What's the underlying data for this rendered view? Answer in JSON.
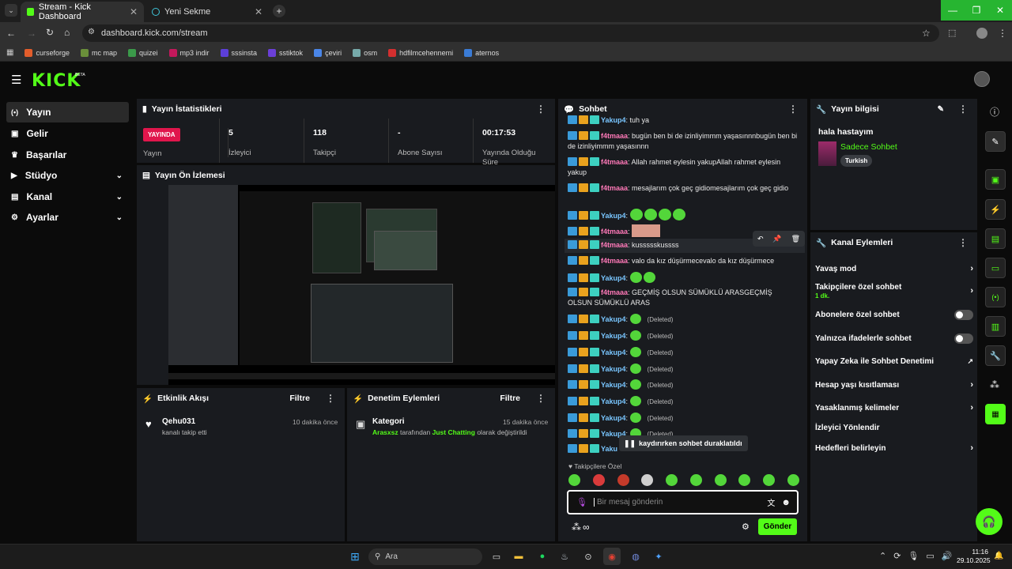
{
  "browser": {
    "tabs": [
      {
        "title": "Stream - Kick Dashboard",
        "active": true
      },
      {
        "title": "Yeni Sekme",
        "active": false
      }
    ],
    "url": "dashboard.kick.com/stream",
    "bookmarks": [
      "curseforge",
      "mc map",
      "quizei",
      "mp3 indir",
      "sssinsta",
      "sstiktok",
      "çeviri",
      "osm",
      "hdfilmcehennemi",
      "aternos"
    ]
  },
  "brand": {
    "logo": "KICK",
    "beta": "BETA",
    "accent": "#53fc18"
  },
  "nav": {
    "items": [
      {
        "label": "Yayın",
        "icon": "broadcast-icon"
      },
      {
        "label": "Gelir",
        "icon": "wallet-icon"
      },
      {
        "label": "Başarılar",
        "icon": "trophy-icon"
      },
      {
        "label": "Stüdyo",
        "icon": "studio-icon"
      },
      {
        "label": "Kanal",
        "icon": "channel-icon"
      },
      {
        "label": "Ayarlar",
        "icon": "gear-icon"
      }
    ]
  },
  "stats": {
    "title": "Yayın İstatistikleri",
    "live_badge": "YAYINDA",
    "live_label": "Yayın",
    "viewers": {
      "value": "5",
      "label": "İzleyici"
    },
    "followers": {
      "value": "118",
      "label": "Takipçi"
    },
    "subs": {
      "value": "-",
      "label": "Abone Sayısı"
    },
    "uptime": {
      "value": "00:17:53",
      "label": "Yayında Olduğu Süre"
    }
  },
  "preview": {
    "title": "Yayın Ön İzlemesi"
  },
  "activity": {
    "title": "Etkinlik Akışı",
    "filter": "Filtre",
    "items": [
      {
        "user": "Qehu031",
        "text": "kanalı takip etti",
        "time": "10 dakika önce"
      }
    ]
  },
  "moderation": {
    "title": "Denetim Eylemleri",
    "filter": "Filtre",
    "items": [
      {
        "title": "Kategori",
        "user": "Arasxsz",
        "mid": "tarafından",
        "category": "Just Chatting",
        "tail": "olarak değiştirildi",
        "time": "15 dakika önce"
      }
    ]
  },
  "chat": {
    "title": "Sohbet",
    "messages": [
      {
        "user": "Yakup4",
        "text": "tuh ya"
      },
      {
        "user": "f4tmaaa",
        "text": "bugün ben bi de izinliyimmm yaşasınnnbugün ben bi de izinliyimmm yaşasınnn"
      },
      {
        "user": "f4tmaaa",
        "text": "Allah rahmet eylesin yakupAllah rahmet eylesin yakup"
      },
      {
        "user": "f4tmaaa",
        "text": "mesajlarım çok geç gidiomesajlarım çok geç gidio"
      },
      {
        "user": "Yakup4",
        "text": ""
      },
      {
        "user": "f4tmaaa",
        "text": ""
      },
      {
        "user": "f4tmaaa",
        "text": "kussssskussss"
      },
      {
        "user": "f4tmaaa",
        "text": "valo da kız düşürmecevalo da kız düşürmece"
      },
      {
        "user": "Yakup4",
        "text": ""
      },
      {
        "user": "f4tmaaa",
        "text": "GEÇMİŞ OLSUN SÜMÜKLÜ ARASGEÇMİŞ OLSUN SÜMÜKLÜ ARAS"
      }
    ],
    "deleted_user": "Yakup4",
    "deleted_label": "(Deleted)",
    "last_user": "Yaku",
    "paused": "kaydırırken sohbet duraklatıldı",
    "followers_only": "Takipçilere Özel",
    "placeholder": "Bir mesaj gönderin",
    "send": "Gönder",
    "infinity": "∞"
  },
  "info": {
    "title": "Yayın bilgisi",
    "stream_title": "hala hastayım",
    "category": "Sadece Sohbet",
    "language": "Turkish"
  },
  "actions": {
    "title": "Kanal Eylemleri",
    "slow": "Yavaş mod",
    "followers": "Takipçilere özel sohbet",
    "followers_sub": "1 dk.",
    "subs": "Abonelere özel sohbet",
    "emotes": "Yalnızca ifadelerle sohbet",
    "ai": "Yapay Zeka ile Sohbet Denetimi",
    "age": "Hesap yaşı kısıtlaması",
    "banned": "Yasaklanmış kelimeler",
    "redirect": "İzleyici Yönlendir",
    "goals": "Hedefleri belirleyin"
  },
  "taskbar": {
    "search": "Ara",
    "time": "11:16",
    "date": "29.10.2025"
  }
}
